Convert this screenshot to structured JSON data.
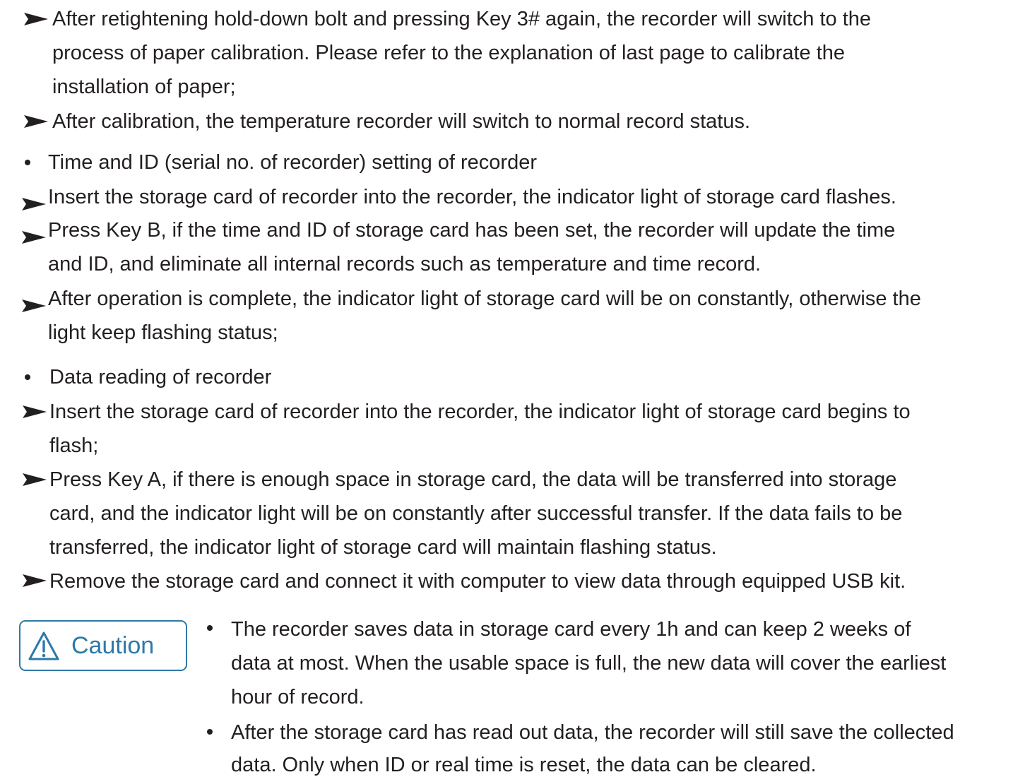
{
  "steps_a": [
    {
      "lines": [
        "After retightening hold-down bolt and pressing Key 3# again, the recorder will switch to the",
        "process of paper calibration. Please refer to the explanation of last page to calibrate the",
        "installation of paper;"
      ]
    },
    {
      "lines": [
        "After calibration, the temperature recorder will switch to normal record status."
      ]
    }
  ],
  "section_time_id": {
    "heading": "Time and ID (serial no. of recorder) setting of recorder",
    "steps": [
      {
        "lines": [
          "Insert the storage card of recorder into the recorder, the indicator light of storage card flashes."
        ]
      },
      {
        "lines": [
          "Press Key B, if the time and ID of storage card has been set, the recorder will update the time",
          "and ID, and eliminate all internal records such as temperature and time record."
        ]
      },
      {
        "lines": [
          "After operation is complete, the indicator light of storage card will be on constantly, otherwise the",
          "light keep flashing status;"
        ]
      }
    ]
  },
  "section_data_reading": {
    "heading": "Data reading of recorder",
    "steps": [
      {
        "lines": [
          "Insert the storage card of recorder into the recorder, the indicator light of storage card begins to",
          "flash;"
        ]
      },
      {
        "lines": [
          "Press Key A, if there is enough space in storage card, the data will be transferred into storage",
          "card, and the indicator light will be on constantly after successful transfer. If the data fails to be",
          "transferred, the indicator light of storage card will maintain flashing status."
        ]
      },
      {
        "lines": [
          "Remove the storage card and connect it with computer to view data through equipped USB kit."
        ]
      }
    ]
  },
  "caution": {
    "label": "Caution",
    "color": "#2d79a7",
    "icon": "warning-triangle-icon",
    "items": [
      {
        "lines": [
          "The recorder saves data in storage card every 1h and can keep 2 weeks of",
          "data at most. When the usable space is full, the new data will cover the earliest",
          "hour of record."
        ]
      },
      {
        "lines": [
          "After the storage card has read out data, the recorder will still save the collected",
          "data. Only when ID or real time is reset, the data can be cleared."
        ]
      }
    ]
  }
}
